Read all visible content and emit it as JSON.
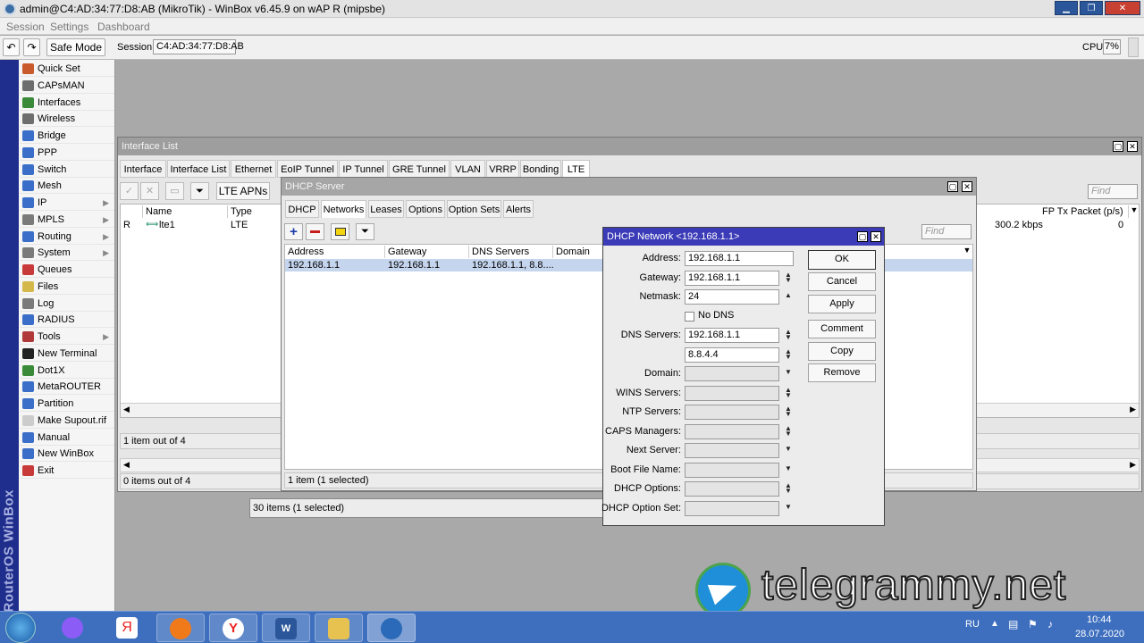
{
  "app": {
    "title": "admin@C4:AD:34:77:D8:AB (MikroTik) - WinBox v6.45.9 on wAP R (mipsbe)"
  },
  "menu": [
    "Session",
    "Settings",
    "Dashboard"
  ],
  "toolbar": {
    "safe_mode": "Safe Mode",
    "session_label": "Session:",
    "session_value": "C4:AD:34:77:D8:AB",
    "cpu_label": "CPU:",
    "cpu_value": "7%"
  },
  "brand": "RouterOS WinBox",
  "sidebar": [
    {
      "label": "Quick Set",
      "icon": "quickset-icon",
      "color": "#c85a2b",
      "sub": false
    },
    {
      "label": "CAPsMAN",
      "icon": "capsman-icon",
      "color": "#6e6e6e",
      "sub": false
    },
    {
      "label": "Interfaces",
      "icon": "interfaces-icon",
      "color": "#3a8a3a",
      "sub": false
    },
    {
      "label": "Wireless",
      "icon": "wireless-icon",
      "color": "#6e6e6e",
      "sub": false
    },
    {
      "label": "Bridge",
      "icon": "bridge-icon",
      "color": "#3a6ec8",
      "sub": false
    },
    {
      "label": "PPP",
      "icon": "ppp-icon",
      "color": "#3a6ec8",
      "sub": false
    },
    {
      "label": "Switch",
      "icon": "switch-icon",
      "color": "#3a6ec8",
      "sub": false
    },
    {
      "label": "Mesh",
      "icon": "mesh-icon",
      "color": "#3a6ec8",
      "sub": false
    },
    {
      "label": "IP",
      "icon": "ip-icon",
      "color": "#3a6ec8",
      "sub": true
    },
    {
      "label": "MPLS",
      "icon": "mpls-icon",
      "color": "#7a7a7a",
      "sub": true
    },
    {
      "label": "Routing",
      "icon": "routing-icon",
      "color": "#3a6ec8",
      "sub": true
    },
    {
      "label": "System",
      "icon": "system-icon",
      "color": "#7a7a7a",
      "sub": true
    },
    {
      "label": "Queues",
      "icon": "queues-icon",
      "color": "#c83a3a",
      "sub": false
    },
    {
      "label": "Files",
      "icon": "files-icon",
      "color": "#d4b84a",
      "sub": false
    },
    {
      "label": "Log",
      "icon": "log-icon",
      "color": "#7a7a7a",
      "sub": false
    },
    {
      "label": "RADIUS",
      "icon": "radius-icon",
      "color": "#3a6ec8",
      "sub": false
    },
    {
      "label": "Tools",
      "icon": "tools-icon",
      "color": "#b03a3a",
      "sub": true
    },
    {
      "label": "New Terminal",
      "icon": "terminal-icon",
      "color": "#222222",
      "sub": false
    },
    {
      "label": "Dot1X",
      "icon": "dot1x-icon",
      "color": "#3a8a3a",
      "sub": false
    },
    {
      "label": "MetaROUTER",
      "icon": "metarouter-icon",
      "color": "#3a6ec8",
      "sub": false
    },
    {
      "label": "Partition",
      "icon": "partition-icon",
      "color": "#3a6ec8",
      "sub": false
    },
    {
      "label": "Make Supout.rif",
      "icon": "supout-icon",
      "color": "#cccccc",
      "sub": false
    },
    {
      "label": "Manual",
      "icon": "manual-icon",
      "color": "#3a6ec8",
      "sub": false
    },
    {
      "label": "New WinBox",
      "icon": "newwinbox-icon",
      "color": "#3a6ec8",
      "sub": false
    },
    {
      "label": "Exit",
      "icon": "exit-icon",
      "color": "#c83a3a",
      "sub": false
    }
  ],
  "interface_list": {
    "title": "Interface List",
    "tabs": [
      "Interface",
      "Interface List",
      "Ethernet",
      "EoIP Tunnel",
      "IP Tunnel",
      "GRE Tunnel",
      "VLAN",
      "VRRP",
      "Bonding",
      "LTE"
    ],
    "lte_apns": "LTE APNs",
    "find_placeholder": "Find",
    "columns": [
      "Name",
      "Type"
    ],
    "right_columns": [
      "FP Tx Packet (p/s)"
    ],
    "row": {
      "flag": "R",
      "name": "lte1",
      "type": "LTE",
      "rate": "300.2 kbps",
      "fp": "0"
    },
    "status": "1 item out of 4",
    "status2": "0 items out of 4",
    "status3": "30 items (1 selected)"
  },
  "dhcp_server": {
    "title": "DHCP Server",
    "tabs": [
      "DHCP",
      "Networks",
      "Leases",
      "Options",
      "Option Sets",
      "Alerts"
    ],
    "find_placeholder": "Find",
    "columns": [
      "Address",
      "Gateway",
      "DNS Servers",
      "Domain"
    ],
    "row": {
      "address": "192.168.1.1",
      "gateway": "192.168.1.1",
      "dns": "192.168.1.1, 8.8...."
    },
    "status": "1 item (1 selected)"
  },
  "dhcp_network": {
    "title": "DHCP Network <192.168.1.1>",
    "labels": {
      "address": "Address:",
      "gateway": "Gateway:",
      "netmask": "Netmask:",
      "no_dns": "No DNS",
      "dns": "DNS Servers:",
      "domain": "Domain:",
      "wins": "WINS Servers:",
      "ntp": "NTP Servers:",
      "caps": "CAPS Managers:",
      "next": "Next Server:",
      "boot": "Boot File Name:",
      "options": "DHCP Options:",
      "optset": "DHCP Option Set:"
    },
    "values": {
      "address": "192.168.1.1",
      "gateway": "192.168.1.1",
      "netmask": "24",
      "dns1": "192.168.1.1",
      "dns2": "8.8.4.4"
    },
    "buttons": {
      "ok": "OK",
      "cancel": "Cancel",
      "apply": "Apply",
      "comment": "Comment",
      "copy": "Copy",
      "remove": "Remove"
    }
  },
  "watermark": "telegrammy.net",
  "taskbar": {
    "lang": "RU",
    "time": "10:44",
    "date": "28.07.2020"
  }
}
